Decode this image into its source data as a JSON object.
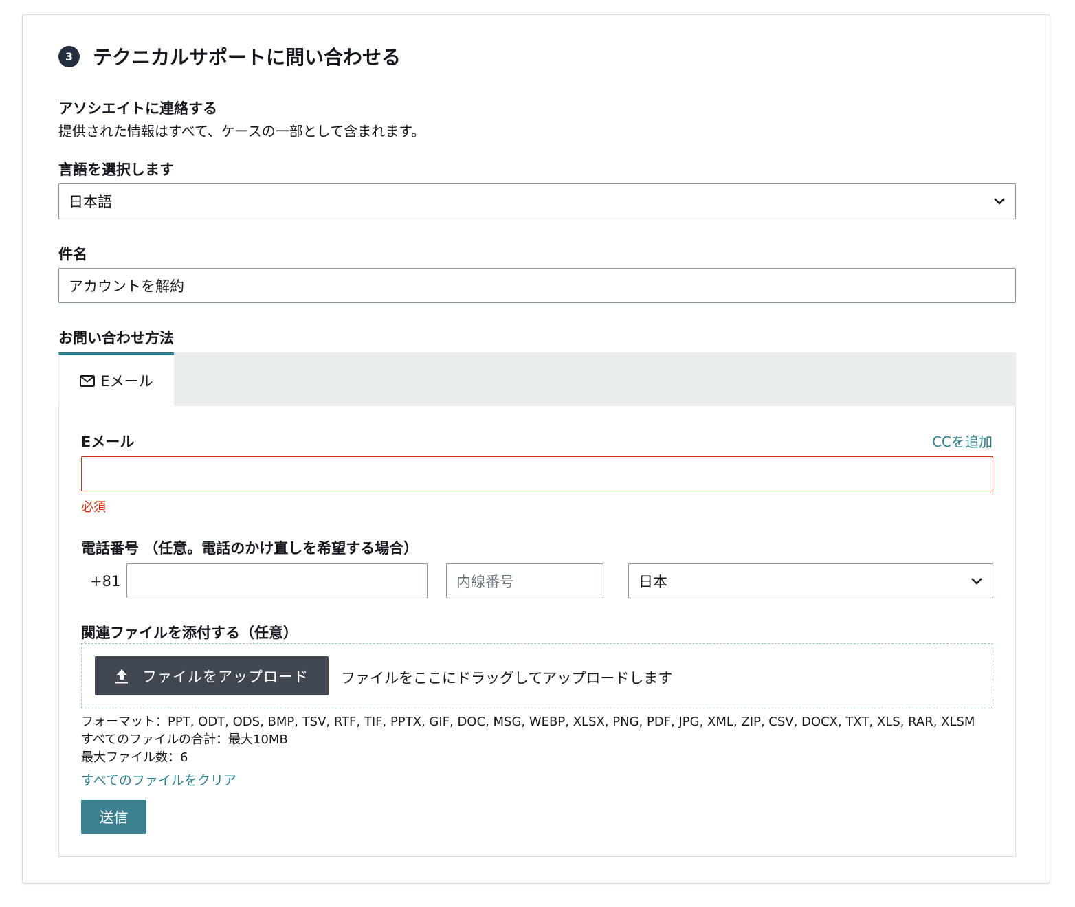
{
  "section": {
    "step_number": "3",
    "title": "テクニカルサポートに問い合わせる"
  },
  "associate": {
    "heading": "アソシエイトに連絡する",
    "description": "提供された情報はすべて、ケースの一部として含まれます。"
  },
  "language": {
    "label": "言語を選択します",
    "selected": "日本語"
  },
  "subject": {
    "label": "件名",
    "value": "アカウントを解約"
  },
  "contact_method": {
    "label": "お問い合わせ方法",
    "tabs": [
      {
        "label": "Eメール",
        "icon": "mail-icon",
        "active": true
      }
    ]
  },
  "email": {
    "label": "Eメール",
    "add_cc": "CCを追加",
    "value": "",
    "error": "必須",
    "error_color": "#d13212"
  },
  "phone": {
    "label": "電話番号 （任意。電話のかけ直しを希望する場合）",
    "country_code": "+81",
    "number_value": "",
    "extension_placeholder": "内線番号",
    "country_selected": "日本"
  },
  "attachments": {
    "label": "関連ファイルを添付する（任意）",
    "upload_button": "ファイルをアップロード",
    "drop_hint": "ファイルをここにドラッグしてアップロードします",
    "formats": "フォーマット：PPT, ODT, ODS, BMP, TSV, RTF, TIF, PPTX, GIF, DOC, MSG, WEBP, XLSX, PNG, PDF, JPG, XML, ZIP, CSV, DOCX, TXT, XLS, RAR, XLSM",
    "total_size": "すべてのファイルの合計：最大10MB",
    "max_files": "最大ファイル数：6",
    "clear_all": "すべてのファイルをクリア"
  },
  "submit": {
    "label": "送信"
  },
  "colors": {
    "accent": "#2d7d8a",
    "submit_bg": "#3d808f",
    "upload_bg": "#414750",
    "badge_bg": "#232f3e"
  }
}
